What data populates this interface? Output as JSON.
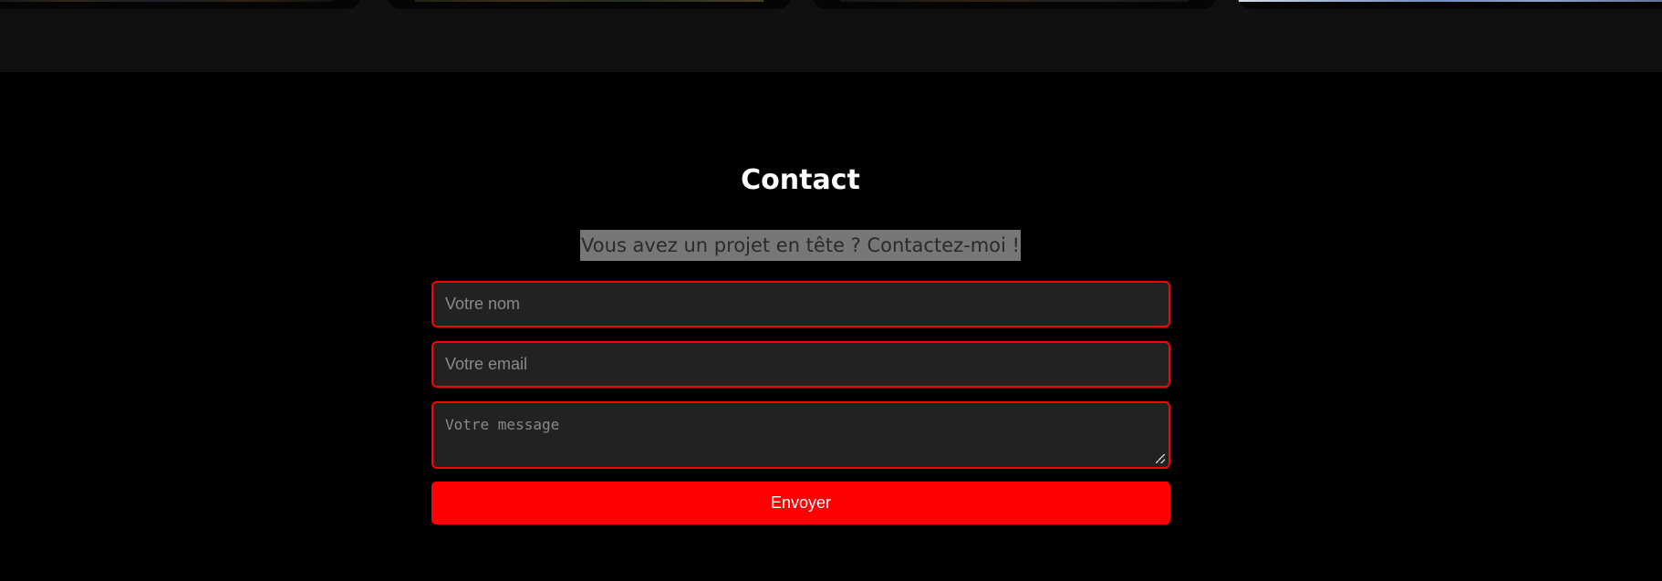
{
  "contact": {
    "title": "Contact",
    "subtitle": "Vous avez un projet en tête ? Contactez-moi !",
    "form": {
      "name_placeholder": "Votre nom",
      "email_placeholder": "Votre email",
      "message_placeholder": "Votre message",
      "submit_label": "Envoyer"
    }
  },
  "colors": {
    "accent": "#ff0000",
    "background": "#000000",
    "field_background": "#222222",
    "top_strip": "#101010"
  }
}
